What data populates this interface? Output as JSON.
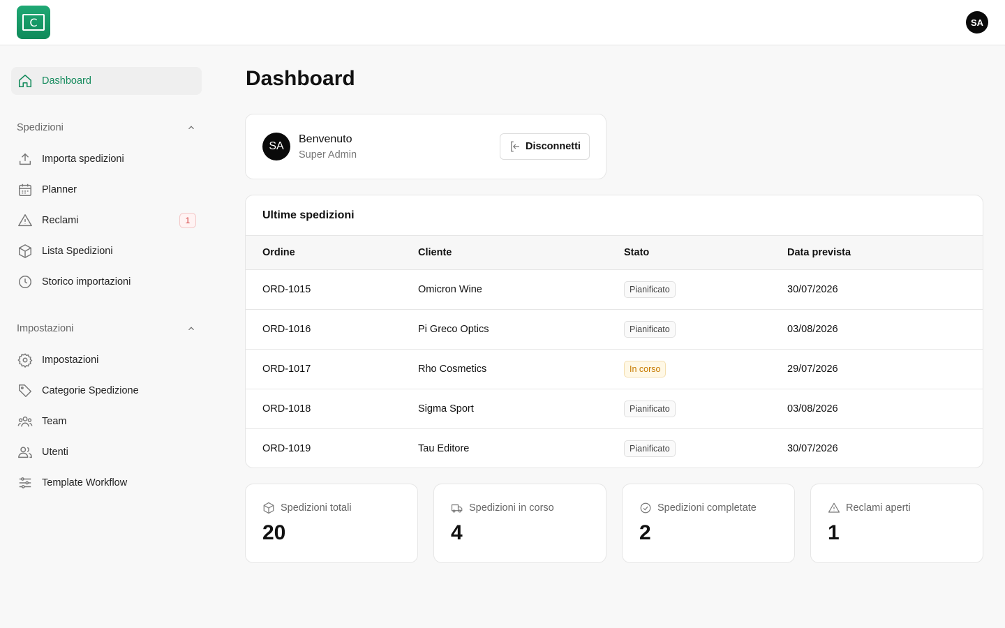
{
  "app": {
    "logo_letter": "C",
    "user_initials": "SA"
  },
  "sidebar": {
    "dashboard_label": "Dashboard",
    "sections": [
      {
        "title": "Spedizioni",
        "items": [
          {
            "label": "Importa spedizioni",
            "icon": "upload-icon"
          },
          {
            "label": "Planner",
            "icon": "calendar-icon"
          },
          {
            "label": "Reclami",
            "icon": "alert-triangle-icon",
            "badge": "1"
          },
          {
            "label": "Lista Spedizioni",
            "icon": "package-icon"
          },
          {
            "label": "Storico importazioni",
            "icon": "clock-icon"
          }
        ]
      },
      {
        "title": "Impostazioni",
        "items": [
          {
            "label": "Impostazioni",
            "icon": "gear-icon"
          },
          {
            "label": "Categorie Spedizione",
            "icon": "tag-icon"
          },
          {
            "label": "Team",
            "icon": "team-icon"
          },
          {
            "label": "Utenti",
            "icon": "users-icon"
          },
          {
            "label": "Template Workflow",
            "icon": "sliders-icon"
          }
        ]
      }
    ]
  },
  "main": {
    "title": "Dashboard",
    "welcome": {
      "initials": "SA",
      "title": "Benvenuto",
      "subtitle": "Super Admin",
      "logout_label": "Disconnetti"
    },
    "table": {
      "title": "Ultime spedizioni",
      "headers": [
        "Ordine",
        "Cliente",
        "Stato",
        "Data prevista"
      ],
      "rows": [
        {
          "order": "ORD-1015",
          "client": "Omicron Wine",
          "status": "Pianificato",
          "date": "30/07/2026"
        },
        {
          "order": "ORD-1016",
          "client": "Pi Greco Optics",
          "status": "Pianificato",
          "date": "03/08/2026"
        },
        {
          "order": "ORD-1017",
          "client": "Rho Cosmetics",
          "status": "In corso",
          "date": "29/07/2026"
        },
        {
          "order": "ORD-1018",
          "client": "Sigma Sport",
          "status": "Pianificato",
          "date": "03/08/2026"
        },
        {
          "order": "ORD-1019",
          "client": "Tau Editore",
          "status": "Pianificato",
          "date": "30/07/2026"
        }
      ]
    },
    "stats": [
      {
        "label": "Spedizioni totali",
        "value": "20",
        "icon": "package-icon"
      },
      {
        "label": "Spedizioni in corso",
        "value": "4",
        "icon": "truck-icon"
      },
      {
        "label": "Spedizioni completate",
        "value": "2",
        "icon": "check-circle-icon"
      },
      {
        "label": "Reclami aperti",
        "value": "1",
        "icon": "alert-triangle-icon"
      }
    ]
  },
  "colors": {
    "accent": "#148a5c",
    "badge_red": "#d23838",
    "status_orange": "#c77a00"
  }
}
